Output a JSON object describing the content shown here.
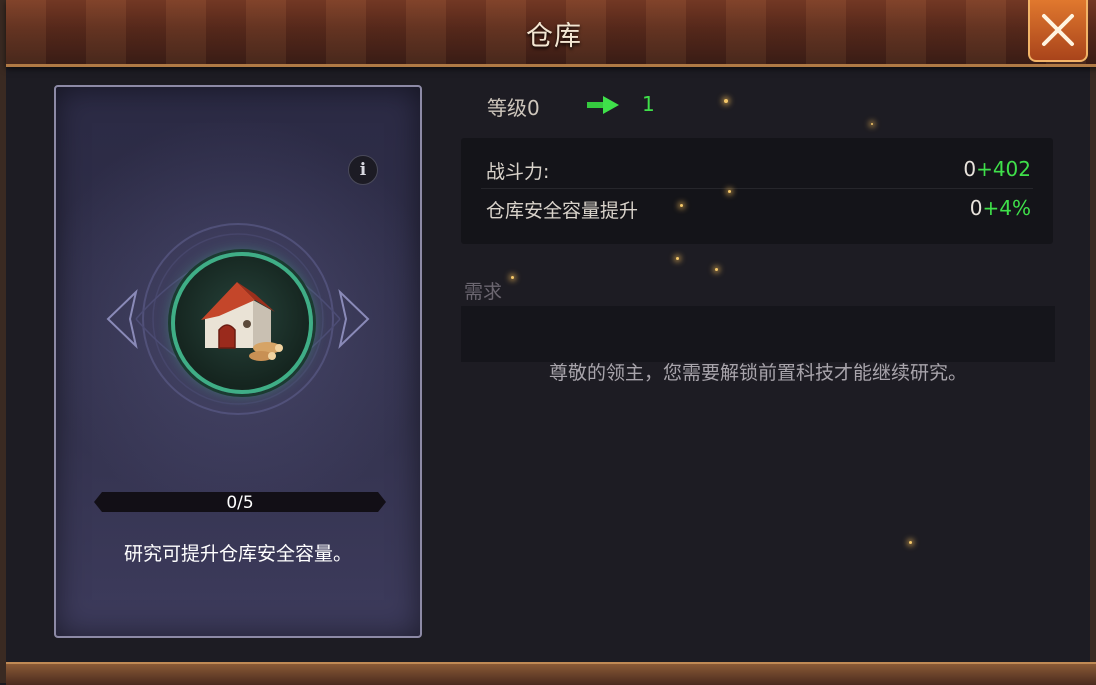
{
  "window": {
    "title": "仓库",
    "close_icon": "close-icon"
  },
  "card": {
    "progress": {
      "text": "0/5",
      "current": 0,
      "max": 5
    },
    "description": "研究可提升仓库安全容量。",
    "building_icon": "warehouse-icon"
  },
  "level": {
    "label": "等级0",
    "next": "1"
  },
  "stats": [
    {
      "label": "战斗力:",
      "base": "0",
      "bonus": "+402"
    },
    {
      "label": "仓库安全容量提升",
      "base": "0",
      "bonus": "+4%"
    }
  ],
  "requirements": {
    "label": "需求",
    "message": "尊敬的领主，您需要解锁前置科技才能继续研究。"
  },
  "colors": {
    "accent_green": "#3fe04a",
    "ring_teal": "#3fae86",
    "close_orange": "#e0782e"
  }
}
